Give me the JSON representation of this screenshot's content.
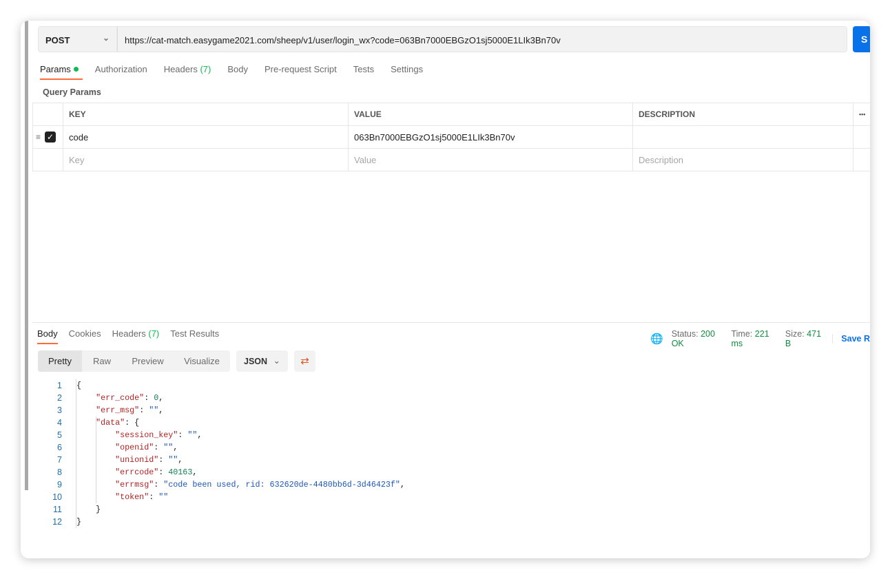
{
  "request": {
    "method": "POST",
    "url": "https://cat-match.easygame2021.com/sheep/v1/user/login_wx?code=063Bn7000EBGzO1sj5000E1LIk3Bn70v",
    "send_label": "S"
  },
  "request_tabs": [
    {
      "label": "Params",
      "count": ""
    },
    {
      "label": "Authorization",
      "count": ""
    },
    {
      "label": "Headers",
      "count": "(7)"
    },
    {
      "label": "Body",
      "count": ""
    },
    {
      "label": "Pre-request Script",
      "count": ""
    },
    {
      "label": "Tests",
      "count": ""
    },
    {
      "label": "Settings",
      "count": ""
    }
  ],
  "query_params": {
    "title": "Query Params",
    "headers": {
      "key": "KEY",
      "value": "VALUE",
      "description": "DESCRIPTION",
      "more": "•••"
    },
    "rows": [
      {
        "key": "code",
        "value": "063Bn7000EBGzO1sj5000E1LIk3Bn70v",
        "description": "",
        "checked": true
      }
    ],
    "placeholders": {
      "key": "Key",
      "value": "Value",
      "description": "Description"
    }
  },
  "response_tabs": [
    {
      "label": "Body",
      "count": ""
    },
    {
      "label": "Cookies",
      "count": ""
    },
    {
      "label": "Headers",
      "count": "(7)"
    },
    {
      "label": "Test Results",
      "count": ""
    }
  ],
  "response_meta": {
    "status_label": "Status:",
    "status": "200 OK",
    "time_label": "Time:",
    "time": "221 ms",
    "size_label": "Size:",
    "size": "471 B",
    "save_label": "Save R"
  },
  "view_modes": [
    "Pretty",
    "Raw",
    "Preview",
    "Visualize"
  ],
  "format": "JSON",
  "colors": {
    "accent": "#ff6c37",
    "primary": "#0a72e8",
    "success": "#0cbb52"
  },
  "code_lines": [
    [
      [
        "p",
        "{"
      ]
    ],
    [
      [
        "p",
        "    "
      ],
      [
        "k",
        "\"err_code\""
      ],
      [
        "p",
        ": "
      ],
      [
        "n",
        "0"
      ],
      [
        "p",
        ","
      ]
    ],
    [
      [
        "p",
        "    "
      ],
      [
        "k",
        "\"err_msg\""
      ],
      [
        "p",
        ": "
      ],
      [
        "s",
        "\"\""
      ],
      [
        "p",
        ","
      ]
    ],
    [
      [
        "p",
        "    "
      ],
      [
        "k",
        "\"data\""
      ],
      [
        "p",
        ": {"
      ]
    ],
    [
      [
        "p",
        "        "
      ],
      [
        "k",
        "\"session_key\""
      ],
      [
        "p",
        ": "
      ],
      [
        "s",
        "\"\""
      ],
      [
        "p",
        ","
      ]
    ],
    [
      [
        "p",
        "        "
      ],
      [
        "k",
        "\"openid\""
      ],
      [
        "p",
        ": "
      ],
      [
        "s",
        "\"\""
      ],
      [
        "p",
        ","
      ]
    ],
    [
      [
        "p",
        "        "
      ],
      [
        "k",
        "\"unionid\""
      ],
      [
        "p",
        ": "
      ],
      [
        "s",
        "\"\""
      ],
      [
        "p",
        ","
      ]
    ],
    [
      [
        "p",
        "        "
      ],
      [
        "k",
        "\"errcode\""
      ],
      [
        "p",
        ": "
      ],
      [
        "n",
        "40163"
      ],
      [
        "p",
        ","
      ]
    ],
    [
      [
        "p",
        "        "
      ],
      [
        "k",
        "\"errmsg\""
      ],
      [
        "p",
        ": "
      ],
      [
        "s",
        "\"code been used, rid: 632620de-4480bb6d-3d46423f\""
      ],
      [
        "p",
        ","
      ]
    ],
    [
      [
        "p",
        "        "
      ],
      [
        "k",
        "\"token\""
      ],
      [
        "p",
        ": "
      ],
      [
        "s",
        "\"\""
      ]
    ],
    [
      [
        "p",
        "    }"
      ]
    ],
    [
      [
        "p",
        "}"
      ]
    ]
  ]
}
